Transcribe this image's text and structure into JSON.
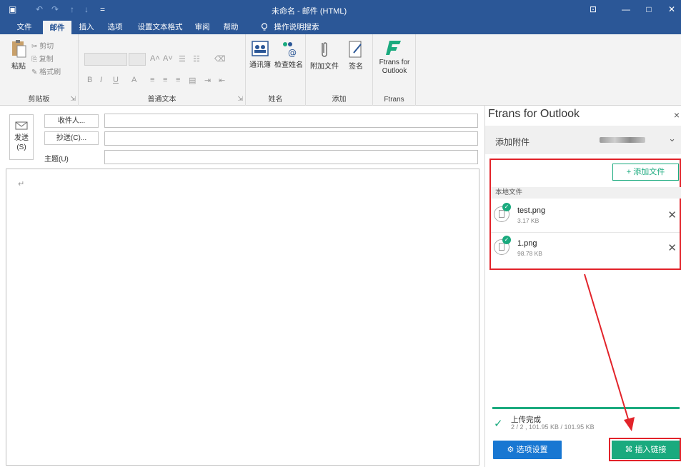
{
  "window": {
    "title": "未命名 - 邮件 (HTML)",
    "controls": [
      "⊡",
      "—",
      "□",
      "✕"
    ]
  },
  "quick_access": [
    "▣",
    "↶",
    "↷",
    "↑",
    "↓",
    "="
  ],
  "tabs": [
    {
      "label": "文件"
    },
    {
      "label": "邮件"
    },
    {
      "label": "插入"
    },
    {
      "label": "选项"
    },
    {
      "label": "设置文本格式"
    },
    {
      "label": "审阅"
    },
    {
      "label": "帮助"
    },
    {
      "label": "操作说明搜索"
    }
  ],
  "ribbon": {
    "clipboard": {
      "paste": "粘贴",
      "cut": "剪切",
      "copy": "复制",
      "format_painter": "格式刷",
      "label": "剪贴板"
    },
    "text": {
      "label": "普通文本"
    },
    "names": {
      "address_book": "通讯簿",
      "check_names": "检查姓名",
      "label": "姓名"
    },
    "include": {
      "attach": "附加文件",
      "signature": "签名",
      "label": "添加"
    },
    "ftrans": {
      "button": "Ftrans for Outlook",
      "label": "Ftrans"
    }
  },
  "compose": {
    "send": "发送\n(S)",
    "to": "收件人...",
    "cc": "抄送(C)...",
    "subject": "主题(U)",
    "para_mark": "↵"
  },
  "pane": {
    "title": "Ftrans for Outlook",
    "close": "×",
    "header": "添加附件",
    "add_file": "+ 添加文件",
    "local_files": "本地文件",
    "files": [
      {
        "name": "test.png",
        "size": "3.17 KB"
      },
      {
        "name": "1.png",
        "size": "98.78 KB"
      }
    ],
    "status_title": "上传完成",
    "status_detail": "2 / 2 , 101.95 KB / 101.95 KB",
    "progress": 1.0,
    "options_button": "⚙ 选项设置",
    "insert_button": "⌘ 插入链接"
  },
  "colors": {
    "title_bar": "#2b5797",
    "accent_green": "#1aaa7e",
    "accent_blue": "#1877d2",
    "annotation_red": "#e2232a"
  }
}
